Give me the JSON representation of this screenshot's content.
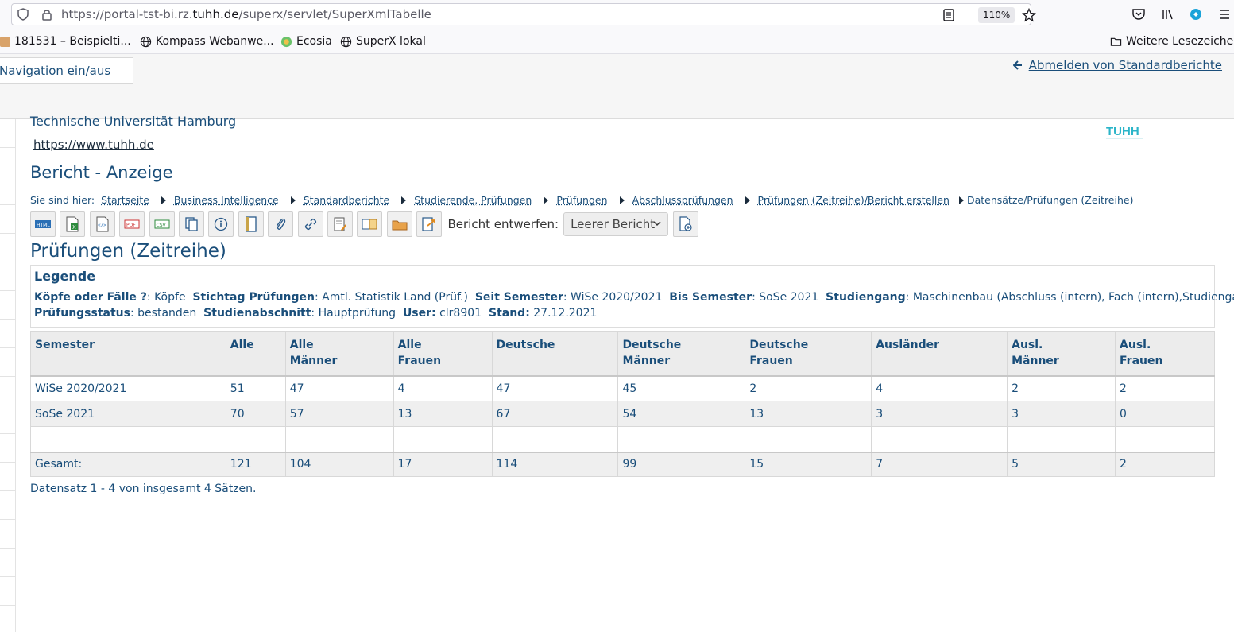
{
  "browser": {
    "url_prefix": "https://portal-tst-bi.rz.",
    "url_domain": "tuhh.de",
    "url_suffix": "/superx/servlet/SuperXmlTabelle",
    "zoom": "110%"
  },
  "bookmarks": [
    {
      "label": "181531 – Beispielti..."
    },
    {
      "label": "Kompass Webanwe..."
    },
    {
      "label": "Ecosia"
    },
    {
      "label": "SuperX lokal"
    }
  ],
  "bookmarks_more": "Weitere Lesezeichen",
  "header": {
    "nav_toggle": "Navigation ein/aus",
    "logout": "Abmelden von Standardberichte"
  },
  "org": {
    "name": "Technische Universität Hamburg",
    "url": "https://www.tuhh.de",
    "logo_text": "TUHH"
  },
  "page_heading": "Bericht - Anzeige",
  "breadcrumb": {
    "prefix": "Sie sind hier:",
    "items": [
      "Startseite",
      "Business Intelligence",
      "Standardberichte",
      "Studierende, Prüfungen",
      "Prüfungen",
      "Abschlussprüfungen",
      "Prüfungen (Zeitreihe)/Bericht erstellen",
      "Datensätze/Prüfungen (Zeitreihe)"
    ]
  },
  "toolbar": {
    "entwerfen_label": "Bericht entwerfen:",
    "select_value": "Leerer Bericht",
    "icons": [
      "html-export-icon",
      "excel-export-icon",
      "xml-export-icon",
      "pdf-export-icon",
      "csv-export-icon",
      "copy-icon",
      "info-icon",
      "notebook-icon",
      "attachment-icon",
      "link-icon",
      "edit-report-icon",
      "compare-icon",
      "folder-icon",
      "export-report-icon"
    ]
  },
  "report_title": "Prüfungen (Zeitreihe)",
  "legend": {
    "title": "Legende",
    "items_line1": [
      {
        "key": "Köpfe oder Fälle ?",
        "value": "Köpfe"
      },
      {
        "key": "Stichtag Prüfungen",
        "value": "Amtl. Statistik Land (Prüf.)"
      },
      {
        "key": "Seit Semester",
        "value": "WiSe 2020/2021"
      },
      {
        "key": "Bis Semester",
        "value": "SoSe 2021"
      },
      {
        "key": "Studiengang",
        "value": "Maschinenbau (Abschluss (intern), Fach (intern),Studiengang)"
      }
    ],
    "items_line2": [
      {
        "key": "Prüfungsstatus",
        "value": "bestanden"
      },
      {
        "key": "Studienabschnitt",
        "value": "Hauptprüfung"
      }
    ],
    "user_label": "User:",
    "user_value": "clr8901",
    "stand_label": "Stand:",
    "stand_value": "27.12.2021"
  },
  "table": {
    "headers": [
      [
        "Semester"
      ],
      [
        "Alle"
      ],
      [
        "Alle",
        "Männer"
      ],
      [
        "Alle",
        "Frauen"
      ],
      [
        "Deutsche"
      ],
      [
        "Deutsche",
        "Männer"
      ],
      [
        "Deutsche",
        "Frauen"
      ],
      [
        "Ausländer"
      ],
      [
        "Ausl.",
        "Männer"
      ],
      [
        "Ausl.",
        "Frauen"
      ]
    ],
    "rows": [
      [
        "WiSe 2020/2021",
        "51",
        "47",
        "4",
        "47",
        "45",
        "2",
        "4",
        "2",
        "2"
      ],
      [
        "SoSe 2021",
        "70",
        "57",
        "13",
        "67",
        "54",
        "13",
        "3",
        "3",
        "0"
      ],
      [
        "",
        "",
        "",
        "",
        "",
        "",
        "",
        "",
        "",
        ""
      ]
    ],
    "total": [
      "Gesamt:",
      "121",
      "104",
      "17",
      "114",
      "99",
      "15",
      "7",
      "5",
      "2"
    ]
  },
  "footer": "Datensatz 1 - 4 von insgesamt 4 Sätzen."
}
